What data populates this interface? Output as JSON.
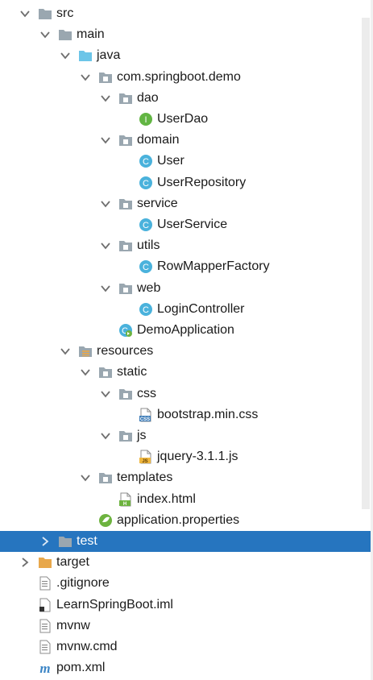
{
  "tree": {
    "items": [
      {
        "label": "src",
        "icon": "folder-icon",
        "expanded": true,
        "depth": 0
      },
      {
        "label": "main",
        "icon": "folder-icon",
        "expanded": true,
        "depth": 1
      },
      {
        "label": "java",
        "icon": "source-folder-icon",
        "expanded": true,
        "depth": 2
      },
      {
        "label": "com.springboot.demo",
        "icon": "package-icon",
        "expanded": true,
        "depth": 3
      },
      {
        "label": "dao",
        "icon": "package-icon",
        "expanded": true,
        "depth": 4
      },
      {
        "label": "UserDao",
        "icon": "interface-icon",
        "badge": "I",
        "depth": 5
      },
      {
        "label": "domain",
        "icon": "package-icon",
        "expanded": true,
        "depth": 4
      },
      {
        "label": "User",
        "icon": "class-icon",
        "badge": "C",
        "depth": 5
      },
      {
        "label": "UserRepository",
        "icon": "class-icon",
        "badge": "C",
        "depth": 5
      },
      {
        "label": "service",
        "icon": "package-icon",
        "expanded": true,
        "depth": 4
      },
      {
        "label": "UserService",
        "icon": "class-icon",
        "badge": "C",
        "depth": 5
      },
      {
        "label": "utils",
        "icon": "package-icon",
        "expanded": true,
        "depth": 4
      },
      {
        "label": "RowMapperFactory",
        "icon": "class-icon",
        "badge": "C",
        "depth": 5
      },
      {
        "label": "web",
        "icon": "package-icon",
        "expanded": true,
        "depth": 4
      },
      {
        "label": "LoginController",
        "icon": "class-icon",
        "badge": "C",
        "depth": 5
      },
      {
        "label": "DemoApplication",
        "icon": "spring-boot-class-icon",
        "badge": "C",
        "depth": 4
      },
      {
        "label": "resources",
        "icon": "resources-folder-icon",
        "expanded": true,
        "depth": 2
      },
      {
        "label": "static",
        "icon": "package-icon",
        "expanded": true,
        "depth": 3
      },
      {
        "label": "css",
        "icon": "package-icon",
        "expanded": true,
        "depth": 4
      },
      {
        "label": "bootstrap.min.css",
        "icon": "css-file-icon",
        "badge": "CSS",
        "depth": 5
      },
      {
        "label": "js",
        "icon": "package-icon",
        "expanded": true,
        "depth": 4
      },
      {
        "label": "jquery-3.1.1.js",
        "icon": "js-file-icon",
        "badge": "JS",
        "depth": 5
      },
      {
        "label": "templates",
        "icon": "package-icon",
        "expanded": true,
        "depth": 3
      },
      {
        "label": "index.html",
        "icon": "html-file-icon",
        "badge": "H",
        "depth": 4
      },
      {
        "label": "application.properties",
        "icon": "spring-properties-icon",
        "depth": 3
      },
      {
        "label": "test",
        "icon": "folder-icon",
        "expanded": false,
        "selected": true,
        "depth": 1
      },
      {
        "label": "target",
        "icon": "excluded-folder-icon",
        "expanded": false,
        "depth": 0
      },
      {
        "label": ".gitignore",
        "icon": "text-file-icon",
        "depth": 0
      },
      {
        "label": "LearnSpringBoot.iml",
        "icon": "iml-file-icon",
        "depth": 0
      },
      {
        "label": "mvnw",
        "icon": "text-file-icon",
        "depth": 0
      },
      {
        "label": "mvnw.cmd",
        "icon": "text-file-icon",
        "depth": 0
      },
      {
        "label": "pom.xml",
        "icon": "maven-file-icon",
        "badge": "m",
        "depth": 0
      }
    ]
  },
  "colors": {
    "selection": "#2675bf",
    "folder": "#9aa7b0",
    "source_folder": "#6cc5e8",
    "class_badge": "#4ab2dc",
    "interface_badge": "#62b543",
    "spring": "#6db33f",
    "css_file": "#3f7db8",
    "js_file": "#f0b73f",
    "html_file": "#6db33f",
    "maven": "#3d86c6",
    "target_folder": "#e8a84c"
  }
}
